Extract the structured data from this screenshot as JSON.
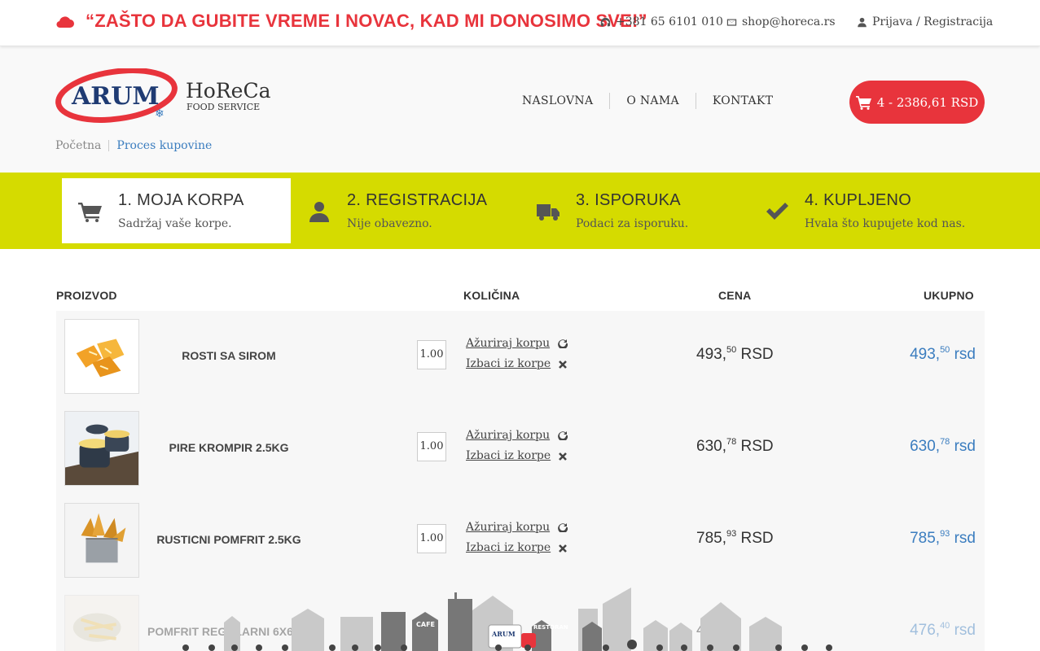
{
  "topbar": {
    "slogan": "“ZAŠTO DA GUBITE VREME I NOVAC, KAD MI DONOSIMO SVE!”",
    "phone": "+381 65 6101 010",
    "email": "shop@horeca.rs",
    "login": "Prijava / Registracija"
  },
  "logo": {
    "brand": "ARUM",
    "name": "HoReCa",
    "tagline": "FOOD SERVICE"
  },
  "nav": {
    "home": "NASLOVNA",
    "about": "O NAMA",
    "contact": "KONTAKT"
  },
  "cart": {
    "label": "4 - 2386,61 RSD"
  },
  "breadcrumb": {
    "home": "Početna",
    "current": "Proces kupovine"
  },
  "steps": [
    {
      "title": "1. MOJA KORPA",
      "subtitle": "Sadržaj vaše korpe.",
      "icon": "cart-icon"
    },
    {
      "title": "2. REGISTRACIJA",
      "subtitle": "Nije obavezno.",
      "icon": "user-icon"
    },
    {
      "title": "3. ISPORUKA",
      "subtitle": "Podaci za isporuku.",
      "icon": "truck-icon"
    },
    {
      "title": "4. KUPLJENO",
      "subtitle": "Hvala što kupujete kod nas.",
      "icon": "check-icon"
    }
  ],
  "table": {
    "headers": {
      "product": "PROIZVOD",
      "quantity": "KOLIČINA",
      "price": "CENA",
      "total": "UKUPNO"
    },
    "update_label": "Ažuriraj korpu",
    "remove_label": "Izbaci iz korpe",
    "rows": [
      {
        "name": "ROSTI SA SIROM",
        "qty": "1.00",
        "price_int": "493,",
        "price_cents": "50",
        "price_cur": " RSD",
        "total_int": "493,",
        "total_cents": "50",
        "total_cur": " rsd"
      },
      {
        "name": "PIRE KROMPIR 2.5KG",
        "qty": "1.00",
        "price_int": "630,",
        "price_cents": "78",
        "price_cur": " RSD",
        "total_int": "630,",
        "total_cents": "78",
        "total_cur": " rsd"
      },
      {
        "name": "RUSTICNI POMFRIT 2.5KG",
        "qty": "1.00",
        "price_int": "785,",
        "price_cents": "93",
        "price_cur": " RSD",
        "total_int": "785,",
        "total_cents": "93",
        "total_cur": " rsd"
      },
      {
        "name": "POMFRIT REGULARNI 6X6 2.5",
        "qty": "1.00",
        "price_int": "4",
        "price_cents": "40",
        "price_cur": " R",
        "total_int": "476,",
        "total_cents": "40",
        "total_cur": " rsd"
      }
    ]
  },
  "skyline": {
    "cafe": "CAFE",
    "restaurant": "RESTORAN",
    "truck_brand": "ARUM"
  },
  "colors": {
    "accent_red": "#e8343c",
    "steps_bg": "#d5db00",
    "link_blue": "#3b7dbf"
  }
}
